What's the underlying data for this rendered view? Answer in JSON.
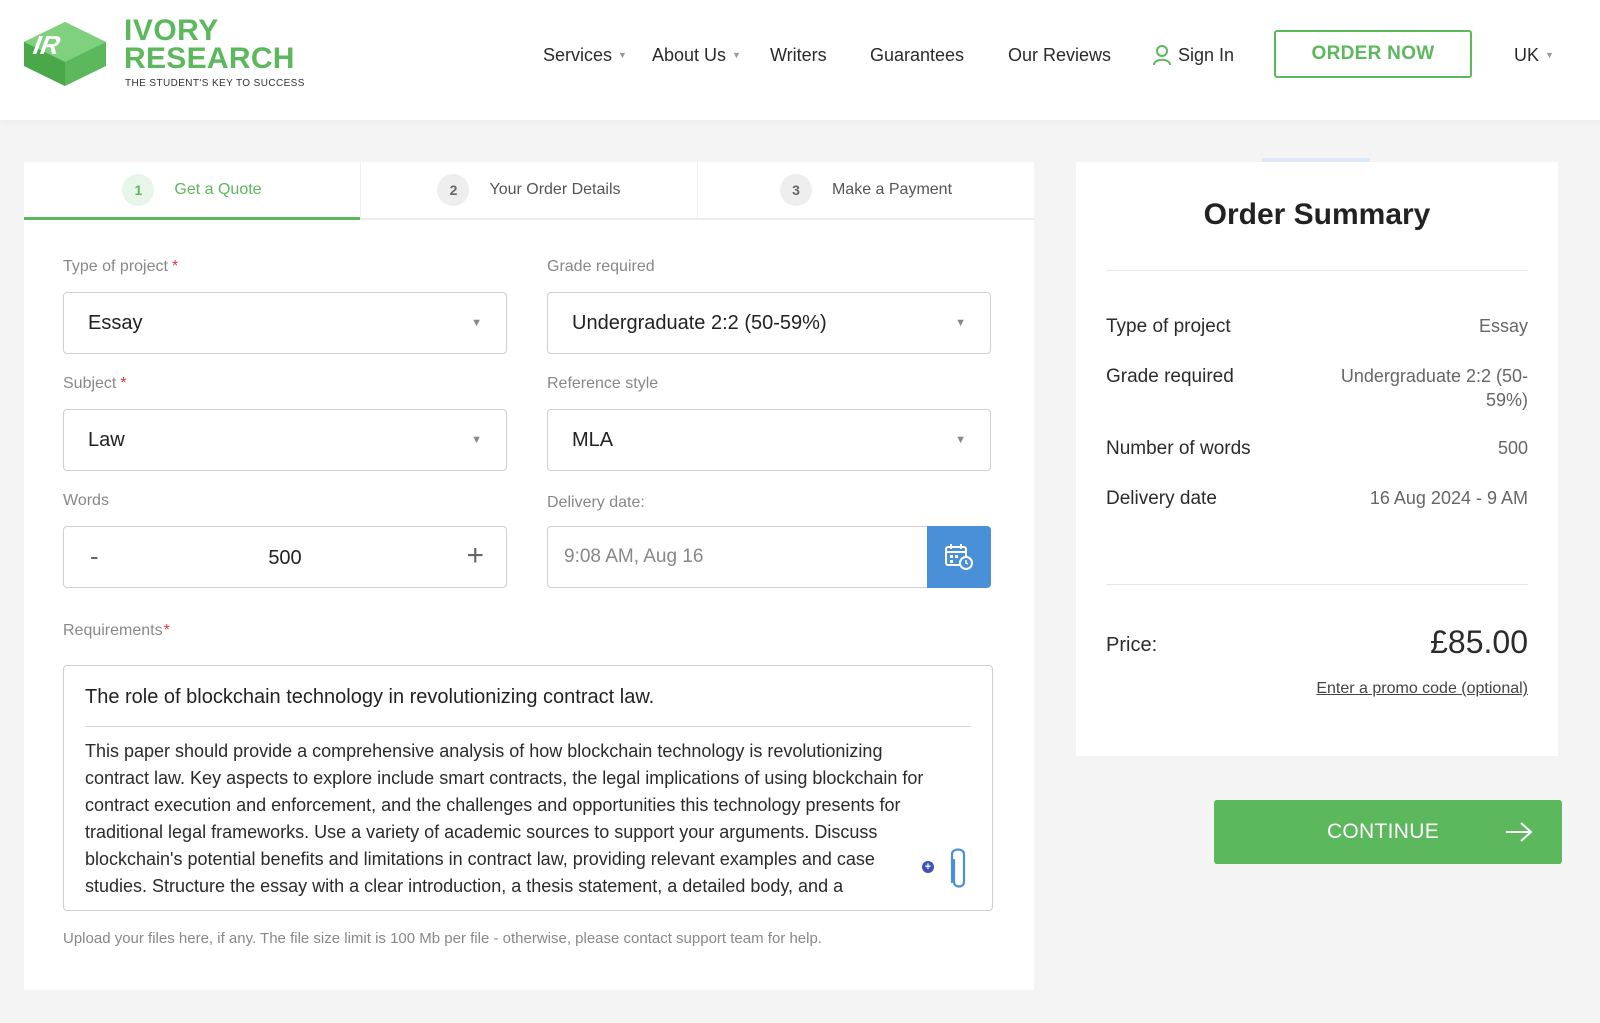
{
  "brand": {
    "line1": "IVORY",
    "line2": "RESEARCH",
    "tagline": "THE STUDENT'S KEY TO SUCCESS",
    "accent": "#5cb85c"
  },
  "nav": {
    "services": "Services",
    "about": "About Us",
    "writers": "Writers",
    "guarantees": "Guarantees",
    "reviews": "Our Reviews",
    "signin": "Sign In",
    "order_now": "ORDER NOW",
    "region": "UK"
  },
  "steps": [
    {
      "num": "1",
      "label": "Get a Quote",
      "active": true
    },
    {
      "num": "2",
      "label": "Your Order Details",
      "active": false
    },
    {
      "num": "3",
      "label": "Make a Payment",
      "active": false
    }
  ],
  "form": {
    "project_label": "Type of project",
    "project_value": "Essay",
    "grade_label": "Grade required",
    "grade_value": "Undergraduate 2:2 (50-59%)",
    "subject_label": "Subject",
    "subject_value": "Law",
    "reference_label": "Reference style",
    "reference_value": "MLA",
    "words_label": "Words",
    "words_value": "500",
    "minus": "-",
    "plus": "+",
    "delivery_label": "Delivery date:",
    "delivery_value": "9:08 AM, Aug 16",
    "requirements_label": "Requirements",
    "requirements_title": "The role of blockchain technology in revolutionizing contract law.",
    "requirements_body": "This paper should provide a comprehensive analysis of how blockchain technology is revolutionizing contract law. Key aspects to explore include smart contracts, the legal implications of using blockchain for contract execution and enforcement, and the challenges and opportunities this technology presents for traditional legal frameworks. Use a variety of academic sources to support your arguments. Discuss blockchain's potential benefits and limitations in contract law, providing relevant examples and case studies. Structure the essay with a clear introduction, a thesis statement, a detailed body, and a",
    "upload_note": "Upload your files here, if any. The file size limit is 100 Mb per file - otherwise, please contact support team for help."
  },
  "summary": {
    "title": "Order Summary",
    "rows": [
      {
        "label": "Type of project",
        "value": "Essay"
      },
      {
        "label": "Grade required",
        "value": "Undergraduate 2:2 (50-59%)"
      },
      {
        "label": "Number of words",
        "value": "500"
      },
      {
        "label": "Delivery date",
        "value": "16 Aug 2024 - 9 AM"
      }
    ],
    "price_label": "Price:",
    "price_value": "£85.00",
    "promo": "Enter a promo code (optional)"
  },
  "continue_label": "CONTINUE",
  "icons": [
    "logo-mark-icon",
    "caret-down-icon",
    "user-icon",
    "calendar-clock-icon",
    "plus-circle-icon",
    "paperclip-icon",
    "arrow-right-icon"
  ]
}
